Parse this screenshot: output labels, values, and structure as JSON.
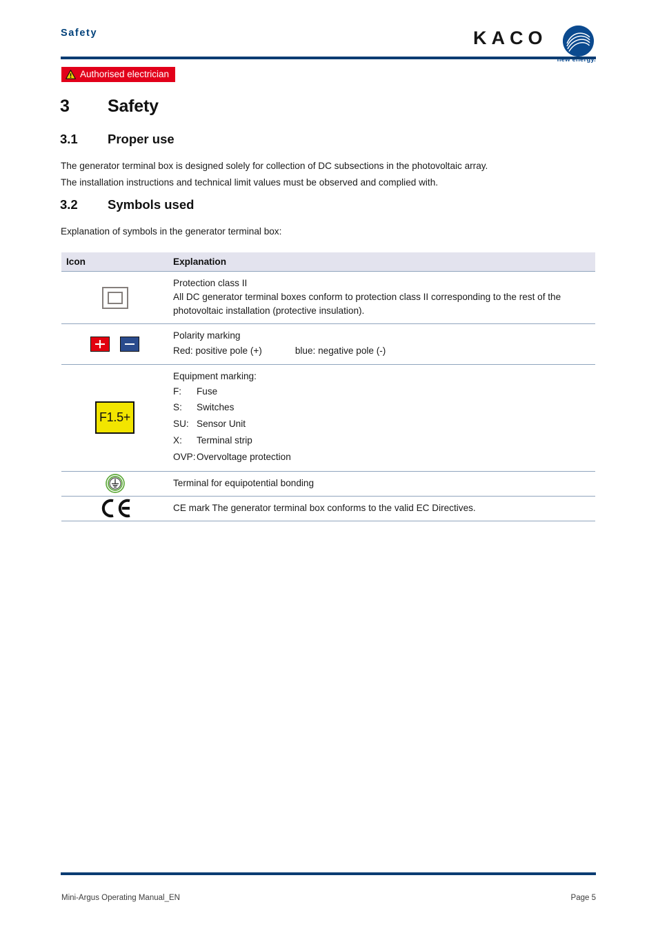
{
  "header": {
    "section_title": "Safety",
    "logo_wordmark": "KACO",
    "logo_tagline": "new energy.",
    "rule_color": "#0a3c72"
  },
  "badge": {
    "label": "Authorised electrician",
    "background": "#e2001a",
    "text_color": "#ffffff",
    "icon": "warning-triangle-icon"
  },
  "headings": {
    "h1_number": "3",
    "h1_text": "Safety",
    "h2_1_number": "3.1",
    "h2_1_text": "Proper use",
    "h2_2_number": "3.2",
    "h2_2_text": "Symbols used"
  },
  "body": {
    "proper_use_p1": "The generator terminal box is designed solely for collection of DC subsections in the photovoltaic array.",
    "proper_use_p2": "The installation instructions and technical limit values must be observed and complied with.",
    "symbols_intro": "Explanation of symbols in the generator terminal box:"
  },
  "table": {
    "header_background": "#e3e3ee",
    "rule_color": "#8fa4bd",
    "columns": [
      "Icon",
      "Explanation"
    ],
    "rows": [
      {
        "icon": "protection-class-ii-icon",
        "icon_colors": {
          "stroke": "#857f7c"
        },
        "lead": "Protection class II",
        "sub": "All DC generator terminal boxes conform to protection class II corresponding to the rest of the photovoltaic installation (protective insulation)."
      },
      {
        "icon": "polarity-marking-icon",
        "icon_colors": {
          "positive": "#e2000f",
          "negative": "#2a4b8d"
        },
        "lead": "Polarity marking",
        "positive_text": "Red: positive pole (+)",
        "negative_text": "blue: negative pole (-)"
      },
      {
        "icon": "equipment-marking-icon",
        "icon_label": "F1.5+",
        "icon_colors": {
          "fill": "#f2e500",
          "border": "#111111"
        },
        "lead": "Equipment marking:",
        "markings": [
          {
            "key": "F:",
            "value": "Fuse"
          },
          {
            "key": "S:",
            "value": "Switches"
          },
          {
            "key": "SU:",
            "value": "Sensor Unit"
          },
          {
            "key": "X:",
            "value": "Terminal strip"
          },
          {
            "key": "OVP:",
            "value": "Overvoltage protection"
          }
        ]
      },
      {
        "icon": "equipotential-bonding-icon",
        "icon_colors": {
          "ring": "#5faa3c",
          "inner": "#444444"
        },
        "lead": "Terminal for equipotential bonding"
      },
      {
        "icon": "ce-mark-icon",
        "lead": "CE mark The generator terminal box conforms to the valid EC Directives."
      }
    ]
  },
  "footer": {
    "document_title": "Mini-Argus Operating Manual_EN",
    "page_label": "Page 5",
    "rule_color": "#0a3c72"
  }
}
